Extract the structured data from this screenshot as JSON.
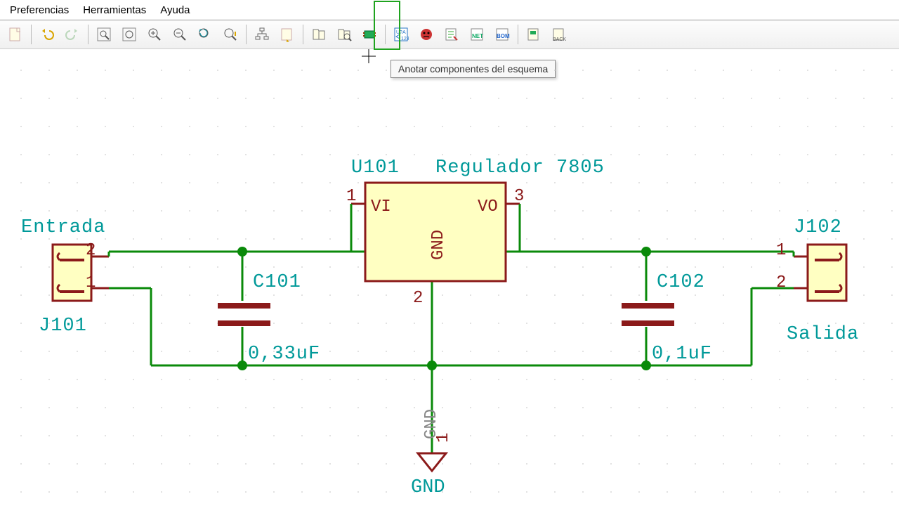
{
  "menu": {
    "pref": "Preferencias",
    "tools": "Herramientas",
    "help": "Ayuda"
  },
  "tooltip": "Anotar componentes del esquema",
  "toolbar_icons": [
    "new-file-icon",
    "undo-icon",
    "redo-icon",
    "zoom-window-icon",
    "zoom-fit-icon",
    "zoom-in-icon",
    "zoom-out-icon",
    "zoom-redraw-icon",
    "zoom-auto-icon",
    "hierarchy-icon",
    "leave-sheet-icon",
    "library-browse-icon",
    "library-search-icon",
    "footprint-icon",
    "annotate-icon",
    "erc-icon",
    "cvpcb-icon",
    "netlist-icon",
    "bom-icon",
    "pcb-icon",
    "back-icon"
  ],
  "schematic": {
    "u101": {
      "ref": "U101",
      "name": "Regulador 7805",
      "vi": "VI",
      "vo": "VO",
      "gnd": "GND",
      "p1": "1",
      "p2": "2",
      "p3": "3"
    },
    "c101": {
      "ref": "C101",
      "val": "0,33uF"
    },
    "c102": {
      "ref": "C102",
      "val": "0,1uF"
    },
    "j101": {
      "ref": "J101",
      "name": "Entrada",
      "p1": "1",
      "p2": "2"
    },
    "j102": {
      "ref": "J102",
      "name": "Salida",
      "p1": "1",
      "p2": "2"
    },
    "gnd": {
      "sym": "GND",
      "label": "GND",
      "p1": "1"
    }
  }
}
